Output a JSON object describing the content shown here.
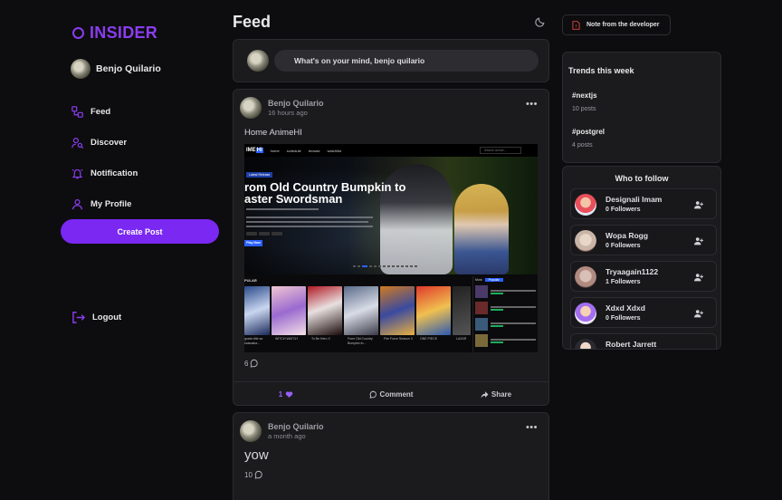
{
  "brand": {
    "name": "INSIDER",
    "accent": "#7a28f2"
  },
  "user": {
    "name": "Benjo Quilario"
  },
  "nav": {
    "items": [
      {
        "label": "Feed",
        "icon": "feed-icon"
      },
      {
        "label": "Discover",
        "icon": "user-search-icon"
      },
      {
        "label": "Notification",
        "icon": "bell-icon"
      },
      {
        "label": "My Profile",
        "icon": "user-icon"
      }
    ],
    "create_label": "Create Post",
    "logout_label": "Logout"
  },
  "feed": {
    "title": "Feed",
    "composer_placeholder": "What's on your mind, benjo quilario",
    "posts": [
      {
        "author": "Benjo Quilario",
        "time": "16 hours ago",
        "text": "Home AnimeHI",
        "comments": "6",
        "likes": "1",
        "comment_label": "Comment",
        "share_label": "Share",
        "screenshot": {
          "logo_a": "IME",
          "logo_b": "HI",
          "nav": [
            "home",
            "schedule",
            "browse",
            "watchlist"
          ],
          "search": "Search anime...",
          "kicker": "Latest Release",
          "title_line1": "rom Old Country Bumpkin to",
          "title_line2": "aster Swordsman",
          "cta": "Play Now",
          "popular_label": "PULAR",
          "covers": [
            {
              "cap": "grade-title sa katanaka..."
            },
            {
              "cap": "WITCH WATCH"
            },
            {
              "cap": "To Be Hero X"
            },
            {
              "cap": "From Old Country Bumpkin to..."
            },
            {
              "cap": "Fire Force Season 3"
            },
            {
              "cap": "ONE PIECE"
            },
            {
              "cap": "LAZAR"
            }
          ],
          "side_tabs": [
            "Most",
            "Popular"
          ]
        }
      },
      {
        "author": "Benjo Quilario",
        "time": "a month ago",
        "text": "yow",
        "comments": "10"
      }
    ]
  },
  "developer_note_label": "Note from the developer",
  "trends": {
    "title": "Trends this week",
    "items": [
      {
        "tag": "#nextjs",
        "count": "10 posts"
      },
      {
        "tag": "#postgrel",
        "count": "4 posts"
      }
    ]
  },
  "who_to_follow": {
    "title": "Who to follow",
    "users": [
      {
        "name": "Designali Imam",
        "followers": "0 Followers",
        "color": "#e94f5a"
      },
      {
        "name": "Wopa Rogg",
        "followers": "0 Followers",
        "color": "#c9b5a8"
      },
      {
        "name": "Tryaagain1122",
        "followers": "1 Followers",
        "color": "#b08a80"
      },
      {
        "name": "Xdxd Xdxd",
        "followers": "0 Followers",
        "color": "#a46ef0"
      },
      {
        "name": "Robert Jarrett",
        "followers": "",
        "color": "#3a3a40"
      }
    ]
  }
}
